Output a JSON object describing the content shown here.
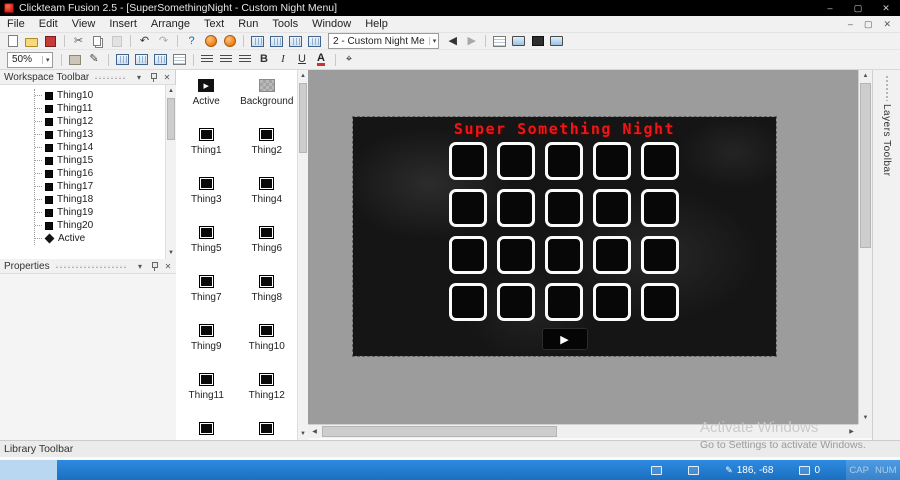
{
  "icons": {
    "minimize": "–",
    "maximize": "▢",
    "close": "✕",
    "chevron_down": "▾",
    "scroll_up": "▲",
    "scroll_down": "▼",
    "scroll_left": "◀",
    "scroll_right": "▶",
    "play": "▶"
  },
  "colors": {
    "accent_red": "#ee1616",
    "statusbar_blue": "#1f7dd2",
    "frame_bg": "#151515"
  },
  "titlebar": {
    "title": "Clickteam Fusion 2.5 - [SuperSomethingNight - Custom Night Menu]"
  },
  "menubar": {
    "items": [
      "File",
      "Edit",
      "View",
      "Insert",
      "Arrange",
      "Text",
      "Run",
      "Tools",
      "Window",
      "Help"
    ]
  },
  "toolbar_main": [
    {
      "name": "new-icon",
      "cls": "ic-page"
    },
    {
      "name": "open-icon",
      "cls": "ic-folder"
    },
    {
      "name": "save-icon",
      "cls": "ic-floppy"
    },
    {
      "type": "sep"
    },
    {
      "name": "cut-icon",
      "glyph": "✂",
      "color": "#555555"
    },
    {
      "name": "copy-icon",
      "cls": "ic-copy"
    },
    {
      "name": "paste-icon",
      "cls": "ic-paste",
      "disabled": true
    },
    {
      "type": "sep"
    },
    {
      "name": "undo-icon",
      "glyph": "↶",
      "color": "#333333"
    },
    {
      "name": "redo-icon",
      "glyph": "↷",
      "color": "#333333",
      "disabled": true
    },
    {
      "type": "sep"
    },
    {
      "name": "help-icon",
      "glyph": "?",
      "color": "#1467c8"
    },
    {
      "name": "run-application-icon",
      "cls": "ic-orange"
    },
    {
      "name": "run-frame-icon",
      "cls": "ic-orange"
    },
    {
      "type": "sep"
    },
    {
      "name": "storyboard-editor-icon",
      "cls": "ic-bluegrid"
    },
    {
      "name": "frame-editor-icon",
      "cls": "ic-bluegrid"
    },
    {
      "name": "event-editor-icon",
      "cls": "ic-bluegrid"
    },
    {
      "name": "event-list-editor-icon",
      "cls": "ic-bluegrid"
    },
    {
      "type": "dropdown",
      "name": "frame-selector-dropdown",
      "value": "2 - Custom Night Me",
      "width": 86
    },
    {
      "name": "previous-frame-icon",
      "glyph": "◀",
      "color": "#333333"
    },
    {
      "name": "next-frame-icon",
      "glyph": "▶",
      "color": "#333333",
      "disabled": true
    },
    {
      "type": "sep"
    },
    {
      "name": "event-line-icon",
      "cls": "ic-lines"
    },
    {
      "name": "screen-preview-icon",
      "cls": "ic-monitor"
    },
    {
      "name": "fullscreen-icon",
      "cls": "ic-dark"
    },
    {
      "name": "window-preview-icon",
      "cls": "ic-monitor"
    }
  ],
  "toolbar_format": [
    {
      "type": "dropdown",
      "name": "zoom-selector-dropdown",
      "value": "50%",
      "width": 26
    },
    {
      "type": "sep"
    },
    {
      "name": "fit-window-icon",
      "cls": "ic-gray"
    },
    {
      "name": "brush-icon",
      "glyph": "✎",
      "color": "#444444"
    },
    {
      "type": "sep"
    },
    {
      "name": "grid-setup-icon",
      "cls": "ic-bluegrid"
    },
    {
      "name": "snap-to-grid-icon",
      "cls": "ic-bluegrid"
    },
    {
      "name": "show-grid-icon",
      "cls": "ic-bluegrid"
    },
    {
      "name": "center-frame-icon",
      "cls": "ic-lines"
    },
    {
      "type": "sep"
    },
    {
      "name": "align-left-icon",
      "cls": "ic-align"
    },
    {
      "name": "align-center-icon",
      "cls": "ic-align"
    },
    {
      "name": "align-right-icon",
      "cls": "ic-align"
    },
    {
      "name": "bold-icon",
      "glyph": "B",
      "cls": "ic-bold",
      "color": "#333333"
    },
    {
      "name": "italic-icon",
      "glyph": "I",
      "cls": "ic-italic",
      "color": "#333333"
    },
    {
      "name": "underline-icon",
      "glyph": "U",
      "cls": "ic-underline",
      "color": "#333333"
    },
    {
      "name": "font-color-icon",
      "glyph": "A",
      "cls": "ic-fontcolor",
      "color": "#222222"
    },
    {
      "type": "sep"
    },
    {
      "name": "crosshair-icon",
      "glyph": "⌖",
      "color": "#333333"
    }
  ],
  "panels": {
    "workspace_title": "Workspace Toolbar",
    "properties_title": "Properties",
    "library_title": "Library Toolbar",
    "layers_title": "Layers Toolbar"
  },
  "workspace_panel": {
    "items": [
      {
        "label": "Thing10",
        "icon": "square"
      },
      {
        "label": "Thing11",
        "icon": "square"
      },
      {
        "label": "Thing12",
        "icon": "square"
      },
      {
        "label": "Thing13",
        "icon": "square"
      },
      {
        "label": "Thing14",
        "icon": "square"
      },
      {
        "label": "Thing15",
        "icon": "square"
      },
      {
        "label": "Thing16",
        "icon": "square"
      },
      {
        "label": "Thing17",
        "icon": "square"
      },
      {
        "label": "Thing18",
        "icon": "square"
      },
      {
        "label": "Thing19",
        "icon": "square"
      },
      {
        "label": "Thing20",
        "icon": "square"
      },
      {
        "label": "Active",
        "icon": "diamond"
      }
    ]
  },
  "objects_panel": {
    "items": [
      {
        "label": "Active",
        "icon": "active"
      },
      {
        "label": "Background",
        "icon": "background"
      },
      {
        "label": "Thing1",
        "icon": "square"
      },
      {
        "label": "Thing2",
        "icon": "square"
      },
      {
        "label": "Thing3",
        "icon": "square"
      },
      {
        "label": "Thing4",
        "icon": "square"
      },
      {
        "label": "Thing5",
        "icon": "square"
      },
      {
        "label": "Thing6",
        "icon": "square"
      },
      {
        "label": "Thing7",
        "icon": "square"
      },
      {
        "label": "Thing8",
        "icon": "square"
      },
      {
        "label": "Thing9",
        "icon": "square"
      },
      {
        "label": "Thing10",
        "icon": "square"
      },
      {
        "label": "Thing11",
        "icon": "square"
      },
      {
        "label": "Thing12",
        "icon": "square"
      },
      {
        "label": "",
        "icon": "square"
      },
      {
        "label": "",
        "icon": "square"
      }
    ]
  },
  "editor": {
    "frame_title": "Super Something Night",
    "grid_rows": 4,
    "grid_cols": 5
  },
  "statusbar": {
    "coordinates": "186, -68",
    "object_count": "0",
    "caps_label": "CAP",
    "num_label": "NUM"
  },
  "watermark": {
    "line1": "Activate Windows",
    "line2": "Go to Settings to activate Windows."
  }
}
